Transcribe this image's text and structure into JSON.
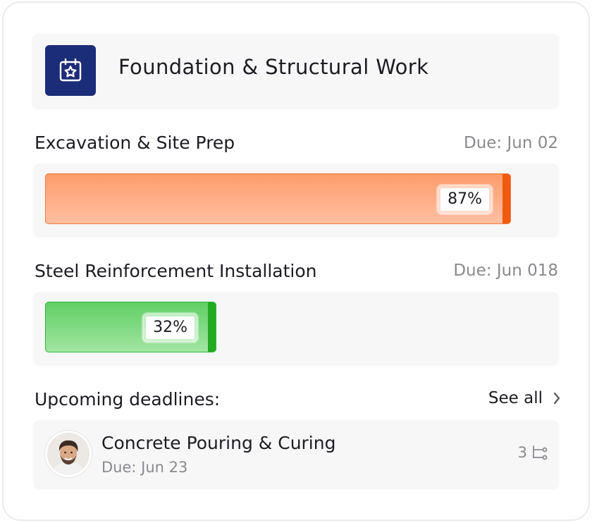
{
  "project": {
    "title": "Foundation & Structural Work",
    "icon": "calendar-star-icon",
    "icon_bg": "#1b2c79"
  },
  "tasks": [
    {
      "name": "Excavation & Site Prep",
      "due": "Due: Jun 02",
      "percent_label": "87%",
      "progress": 0.87,
      "color": "#f05a0e"
    },
    {
      "name": "Steel Reinforcement Installation",
      "due": "Due: Jun 018",
      "percent_label": "32%",
      "progress": 0.32,
      "color": "#22aa22"
    }
  ],
  "upcoming": {
    "title": "Upcoming deadlines:",
    "see_all": "See all",
    "see_all_icon": "chevron-right-icon",
    "items": [
      {
        "title": "Concrete Pouring & Curing",
        "due": "Due: Jun 23",
        "subtask_count": "3",
        "subtask_icon": "subtasks-icon",
        "avatar": "user-avatar"
      }
    ]
  }
}
